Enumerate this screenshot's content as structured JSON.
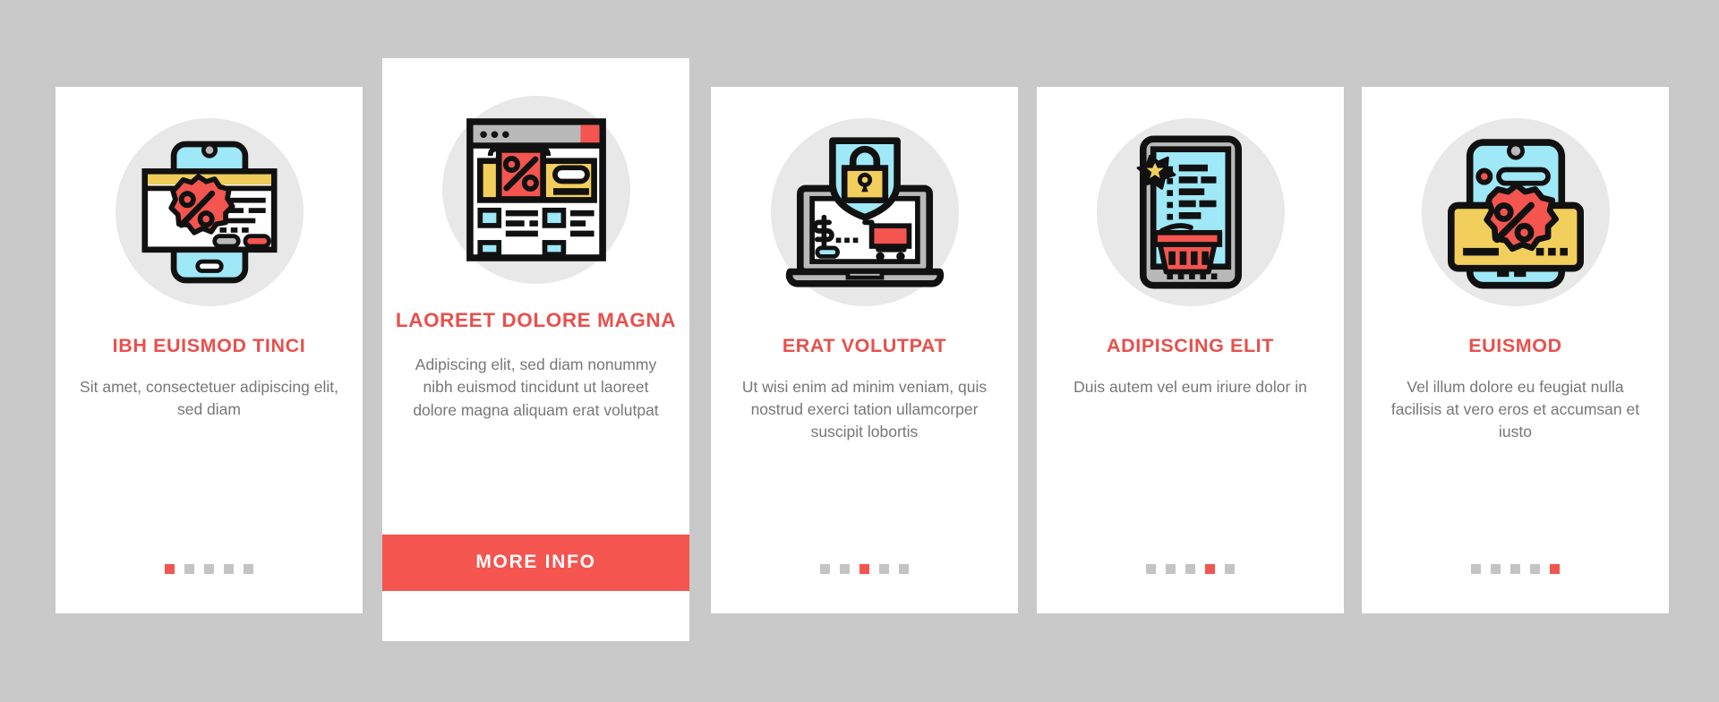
{
  "page": {
    "background_color": "#c9c9c9",
    "card_background": "#ffffff",
    "accent_color": "#f4554f",
    "title_color": "#e8504c",
    "body_color": "#777777",
    "dot_inactive_color": "#c4c4c4",
    "icon_circle_color": "#e8e8e8"
  },
  "cards": [
    {
      "id": "card-1",
      "icon_name": "smartphone-discount-banner-icon",
      "title": "IBH EUISMOD TINCI",
      "body": "Sit amet, consectetuer adipiscing elit, sed diam",
      "dots": {
        "count": 5,
        "active_index": 0
      },
      "featured": false
    },
    {
      "id": "card-2",
      "icon_name": "browser-window-sale-banner-icon",
      "title": "LAOREET DOLORE MAGNA",
      "body": "Adipiscing elit, sed diam nonummy nibh euismod tincidunt ut laoreet dolore magna aliquam erat volutpat",
      "dots": {
        "count": 0,
        "active_index": -1
      },
      "featured": true,
      "button_label": "MORE INFO"
    },
    {
      "id": "card-3",
      "icon_name": "laptop-secure-shopping-shield-icon",
      "title": "ERAT VOLUTPAT",
      "body": "Ut wisi enim ad minim veniam, quis nostrud exerci tation ullamcorper suscipit lobortis",
      "dots": {
        "count": 5,
        "active_index": 2
      },
      "featured": false
    },
    {
      "id": "card-4",
      "icon_name": "tablet-shopping-basket-list-icon",
      "title": "ADIPISCING ELIT",
      "body": "Duis autem vel eum iriure dolor in",
      "dots": {
        "count": 5,
        "active_index": 3
      },
      "featured": false
    },
    {
      "id": "card-5",
      "icon_name": "smartphone-discount-card-icon",
      "title": "EUISMOD",
      "body": "Vel illum dolore eu feugiat nulla facilisis at vero eros et accumsan et iusto",
      "dots": {
        "count": 5,
        "active_index": 4
      },
      "featured": false
    }
  ]
}
